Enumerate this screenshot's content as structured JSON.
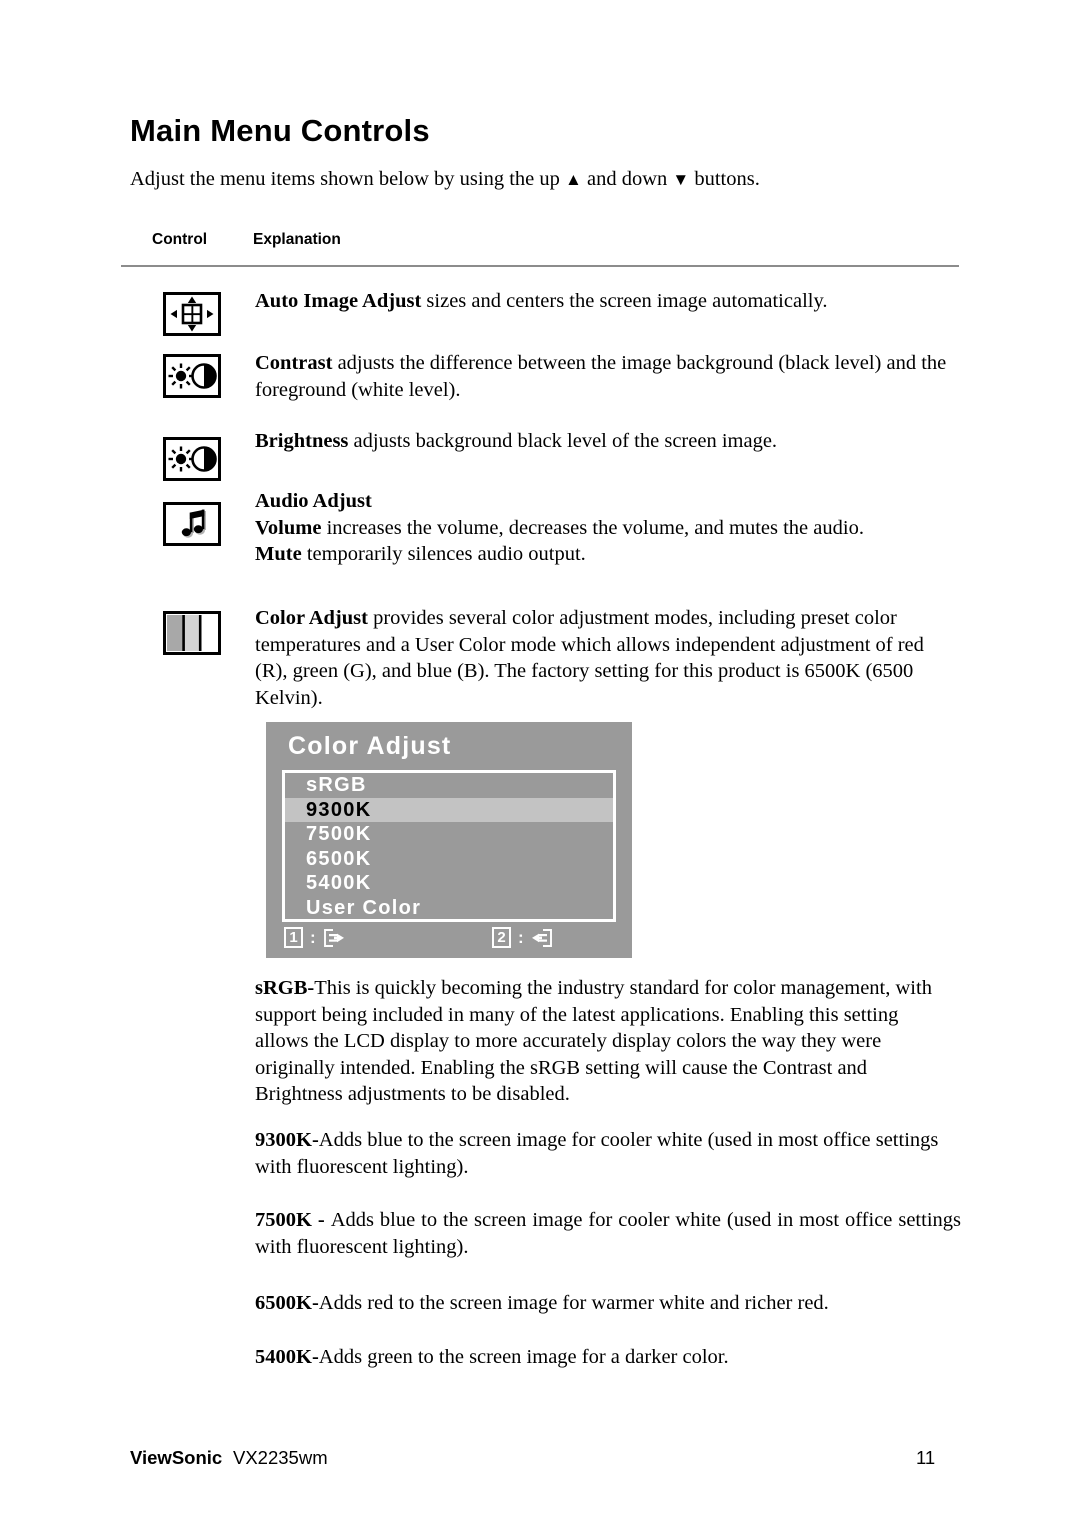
{
  "document": {
    "title": "Main Menu Controls",
    "intro_before": "Adjust the menu items shown below by using the up ",
    "intro_up_symbol": "▲",
    "intro_middle": " and down ",
    "intro_down_symbol": "▼",
    "intro_after": " buttons."
  },
  "table": {
    "header_control": "Control",
    "header_explanation": "Explanation"
  },
  "controls": [
    {
      "icon": "auto-image-adjust-icon",
      "term": "Auto Image Adjust",
      "text": " sizes and centers the screen image automatically."
    },
    {
      "icon": "contrast-icon",
      "term": "Contrast",
      "text": " adjusts the difference between the image background  (black level) and the foreground (white level)."
    },
    {
      "icon": "brightness-icon",
      "term": "Brightness",
      "text": " adjusts background black level of the screen image."
    },
    {
      "icon": "audio-adjust-icon",
      "heading": "Audio Adjust",
      "term": "Volume",
      "text": " increases the volume, decreases the volume, and mutes the audio.",
      "term2": "Mute",
      "text2": " temporarily silences audio output."
    },
    {
      "icon": "color-adjust-icon",
      "term": "Color Adjust",
      "text": " provides several color adjustment modes, including preset color temperatures and a User Color mode which allows independent adjustment of red (R), green (G), and blue (B). The factory setting for this product is 6500K (6500 Kelvin)."
    }
  ],
  "osd": {
    "title": "Color Adjust",
    "items": [
      {
        "label": "sRGB",
        "selected": false
      },
      {
        "label": "9300K",
        "selected": true
      },
      {
        "label": "7500K",
        "selected": false
      },
      {
        "label": "6500K",
        "selected": false
      },
      {
        "label": "5400K",
        "selected": false
      },
      {
        "label": "User Color",
        "selected": false
      }
    ],
    "hint_one_key": "1",
    "hint_one_colon": ":",
    "hint_two_key": "2",
    "hint_two_colon": ":",
    "colors": {
      "background": "#9a9a9a",
      "highlight": "#c3c3c3",
      "text": "#ffffff",
      "selected_text": "#000000"
    }
  },
  "descriptions": [
    {
      "term": "sRGB-",
      "text": "This is quickly becoming the industry standard for color management, with support being included in many of the latest applications. Enabling this setting allows the LCD display to more accurately display colors the way they were originally intended. Enabling the sRGB setting will cause the Contrast and Brightness adjustments to be disabled."
    },
    {
      "term": "9300K-",
      "text": "Adds blue to the screen image for cooler white (used in most office settings with fluorescent lighting)."
    },
    {
      "term": "7500K - ",
      "text": "Adds blue to the screen image for cooler white (used in most office settings with fluorescent lighting)."
    },
    {
      "term": "6500K-",
      "text": "Adds red to the screen image for warmer white and richer red."
    },
    {
      "term": "5400K-",
      "text": "Adds green to the screen image for a darker color."
    }
  ],
  "footer": {
    "brand": "ViewSonic",
    "model": "VX2235wm",
    "page_number": "11"
  }
}
